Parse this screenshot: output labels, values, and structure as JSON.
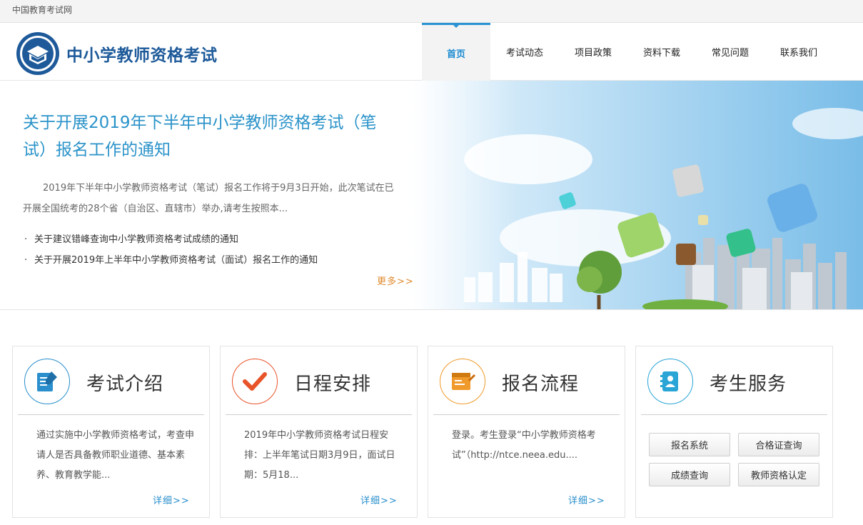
{
  "topbar": {
    "site_name": "中国教育考试网"
  },
  "header": {
    "title": "中小学教师资格考试"
  },
  "nav": [
    {
      "label": "首页",
      "active": true
    },
    {
      "label": "考试动态",
      "active": false
    },
    {
      "label": "项目政策",
      "active": false
    },
    {
      "label": "资料下载",
      "active": false
    },
    {
      "label": "常见问题",
      "active": false
    },
    {
      "label": "联系我们",
      "active": false
    }
  ],
  "banner": {
    "headline": "关于开展2019年下半年中小学教师资格考试（笔试）报名工作的通知",
    "summary": "2019年下半年中小学教师资格考试（笔试）报名工作将于9月3日开始，此次笔试在已开展全国统考的28个省（自治区、直辖市）举办,请考生按照本...",
    "links": [
      "关于建议错峰查询中小学教师资格考试成绩的通知",
      "关于开展2019年上半年中小学教师资格考试（面试）报名工作的通知"
    ],
    "more_label": "更多>>"
  },
  "cards": [
    {
      "title": "考试介绍",
      "text": "通过实施中小学教师资格考试，考查申请人是否具备教师职业道德、基本素养、教育教学能...",
      "detail_label": "详细>>",
      "color": "#2a8fcc",
      "icon": "edit-document-icon"
    },
    {
      "title": "日程安排",
      "text": "2019年中小学教师资格考试日程安排：上半年笔试日期3月9日，面试日期：5月18...",
      "detail_label": "详细>>",
      "color": "#e8542a",
      "icon": "checkmark-icon"
    },
    {
      "title": "报名流程",
      "text": "登录。考生登录“中小学教师资格考试”（http://ntce.neea.edu....",
      "detail_label": "详细>>",
      "color": "#ef9a2a",
      "icon": "register-form-icon"
    },
    {
      "title": "考生服务",
      "color": "#2aa5d6",
      "icon": "contact-book-icon",
      "services": [
        "报名系统",
        "合格证查询",
        "成绩查询",
        "教师资格认定"
      ]
    }
  ]
}
